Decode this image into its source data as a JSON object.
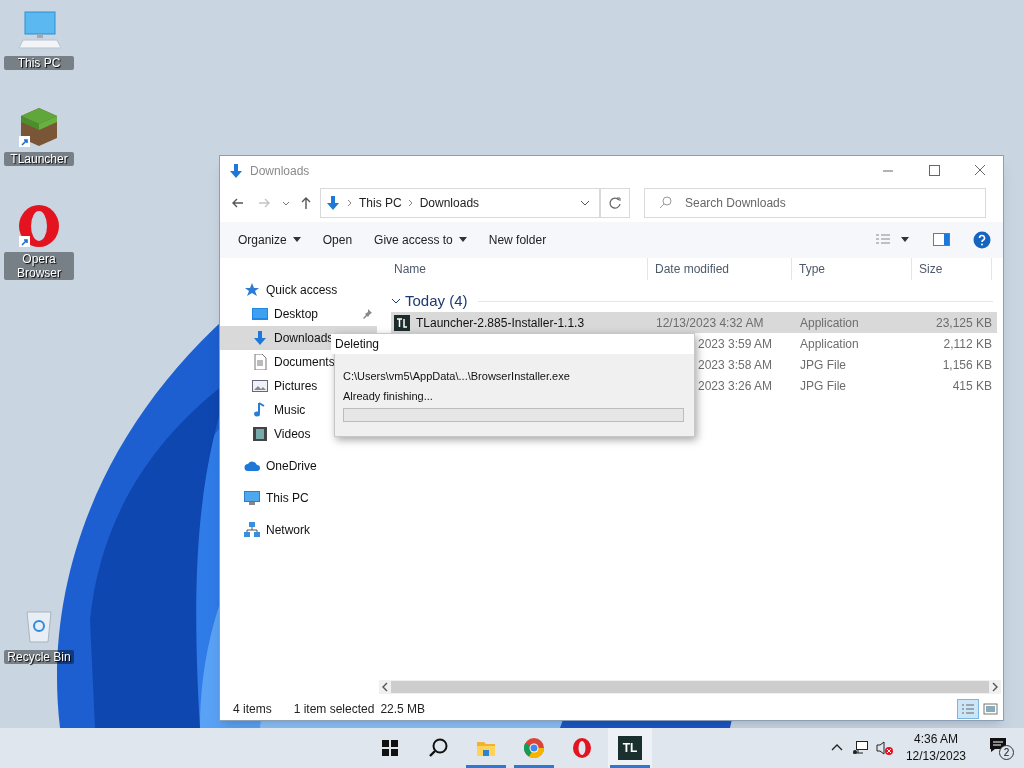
{
  "desktop_icons": [
    {
      "label": "This PC",
      "kind": "pc",
      "shortcut": false
    },
    {
      "label": "TLauncher",
      "kind": "cube",
      "shortcut": true
    },
    {
      "label": "Opera Browser",
      "kind": "opera",
      "shortcut": true
    },
    {
      "label": "Recycle Bin",
      "kind": "bin",
      "shortcut": false
    }
  ],
  "explorer": {
    "title": "Downloads",
    "breadcrumb": [
      "This PC",
      "Downloads"
    ],
    "search": {
      "placeholder": "Search Downloads"
    },
    "commands": [
      {
        "label": "Organize",
        "dropdown": true
      },
      {
        "label": "Open",
        "dropdown": false
      },
      {
        "label": "Give access to",
        "dropdown": true
      },
      {
        "label": "New folder",
        "dropdown": false
      }
    ],
    "sidebar": [
      {
        "label": "Quick access",
        "kind": "star",
        "selected": false,
        "children": [
          {
            "label": "Desktop",
            "kind": "desktop",
            "selected": false,
            "pinned": true
          },
          {
            "label": "Downloads",
            "kind": "download",
            "selected": true,
            "pinned": false
          },
          {
            "label": "Documents",
            "kind": "document",
            "selected": false,
            "pinned": false
          },
          {
            "label": "Pictures",
            "kind": "pictures",
            "selected": false,
            "pinned": false
          },
          {
            "label": "Music",
            "kind": "music",
            "selected": false,
            "pinned": false
          },
          {
            "label": "Videos",
            "kind": "videos",
            "selected": false,
            "pinned": false
          }
        ]
      },
      {
        "label": "OneDrive",
        "kind": "cloud",
        "selected": false
      },
      {
        "label": "This PC",
        "kind": "pc",
        "selected": false
      },
      {
        "label": "Network",
        "kind": "network",
        "selected": false
      }
    ],
    "columns": [
      "Name",
      "Date modified",
      "Type",
      "Size"
    ],
    "group": {
      "label": "Today (4)",
      "expanded": true
    },
    "rows": [
      {
        "name": "TLauncher-2.885-Installer-1.1.3",
        "date": "12/13/2023 4:32 AM",
        "date_clipped": false,
        "type": "Application",
        "size": "23,125 KB",
        "selected": true
      },
      {
        "date": "2023 3:59 AM",
        "date_clipped": true,
        "type": "Application",
        "size": "2,112 KB",
        "selected": false
      },
      {
        "date": "2023 3:58 AM",
        "date_clipped": true,
        "type": "JPG File",
        "size": "1,156 KB",
        "selected": false
      },
      {
        "date": "2023 3:26 AM",
        "date_clipped": true,
        "type": "JPG File",
        "size": "415 KB",
        "selected": false
      }
    ],
    "status": [
      "4 items",
      "1 item selected",
      "22.5 MB"
    ]
  },
  "dialog": {
    "title": "Deleting",
    "path": "C:\\Users\\vm5\\AppData\\...\\BrowserInstaller.exe",
    "message": "Already finishing...",
    "level": 0
  },
  "taskbar": {
    "apps": [
      {
        "kind": "start",
        "running": false,
        "selected": false
      },
      {
        "kind": "search",
        "running": false,
        "selected": false
      },
      {
        "kind": "explorer",
        "running": true,
        "selected": false
      },
      {
        "kind": "chrome",
        "running": true,
        "selected": false
      },
      {
        "kind": "opera",
        "running": false,
        "selected": false
      },
      {
        "kind": "tlauncher",
        "label": "TL",
        "running": true,
        "selected": true
      }
    ],
    "time": "4:36 AM",
    "date": "12/13/2023",
    "notifications": "2"
  }
}
